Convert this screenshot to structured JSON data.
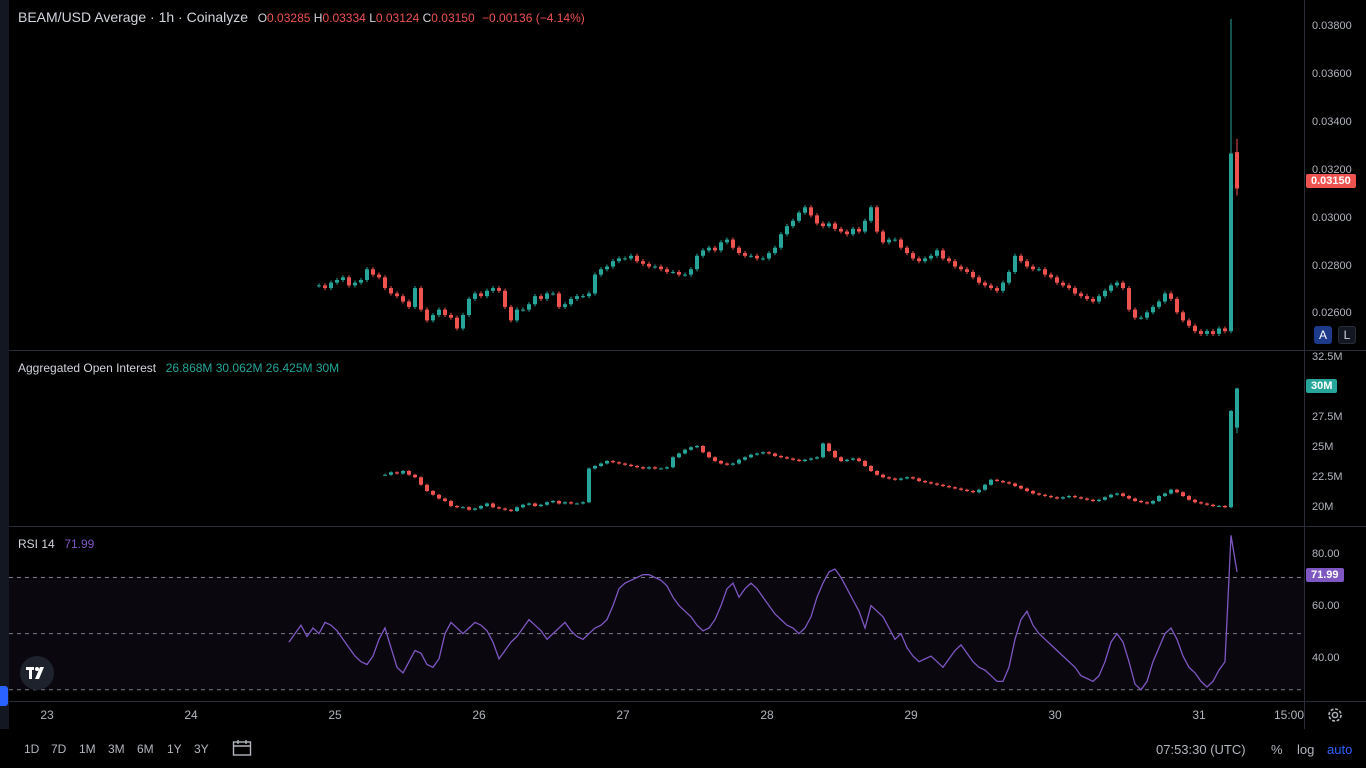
{
  "price_legend": {
    "title": "BEAM/USD Average · 1h · Coinalyze",
    "o_label": "O",
    "o": "0.03285",
    "h_label": "H",
    "h": "0.03334",
    "l_label": "L",
    "l": "0.03124",
    "c_label": "C",
    "c": "0.03150",
    "change": "−0.00136 (−4.14%)"
  },
  "oi_legend": {
    "title": "Aggregated Open Interest",
    "values": "26.868M 30.062M 26.425M 30M"
  },
  "rsi_legend": {
    "title": "RSI 14",
    "value": "71.99"
  },
  "price_axis": {
    "ticks": [
      "0.03800",
      "0.03600",
      "0.03400",
      "0.03200",
      "0.03000",
      "0.02800",
      "0.02600"
    ],
    "last_price": "0.03150"
  },
  "oi_axis": {
    "ticks": [
      "32.5M",
      "27.5M",
      "25M",
      "22.5M",
      "20M"
    ],
    "last": "30M"
  },
  "rsi_axis": {
    "ticks": [
      "80.00",
      "60.00",
      "40.00"
    ],
    "last": "71.99"
  },
  "scale_buttons": {
    "auto_label": "A",
    "log_label": "L"
  },
  "time_axis": {
    "ticks": [
      "23",
      "24",
      "25",
      "26",
      "27",
      "28",
      "29",
      "30",
      "31",
      "15:00"
    ]
  },
  "toolbar": {
    "ranges": [
      "1D",
      "7D",
      "1M",
      "3M",
      "6M",
      "1Y",
      "3Y"
    ],
    "clock": "07:53:30 (UTC)",
    "percent": "%",
    "log": "log",
    "auto": "auto"
  },
  "colors": {
    "up": "#26a69a",
    "down": "#ef5350",
    "rsi": "#7e57c2",
    "accent": "#2962ff"
  },
  "chart_data": [
    {
      "type": "candlestick",
      "name": "BEAM/USD price, 1h",
      "x_range": [
        "22 (partial)",
        "31 15:00"
      ],
      "ylim": [
        0.0255,
        0.0385
      ],
      "closes": [
        0.0279,
        0.0278,
        0.028,
        0.0281,
        0.0282,
        0.0279,
        0.028,
        0.0281,
        0.0285,
        0.0283,
        0.0282,
        0.0278,
        0.0276,
        0.0275,
        0.0273,
        0.0271,
        0.0278,
        0.027,
        0.0266,
        0.0268,
        0.027,
        0.0268,
        0.0267,
        0.0263,
        0.0268,
        0.0274,
        0.0276,
        0.0275,
        0.0277,
        0.0278,
        0.0277,
        0.0271,
        0.0266,
        0.027,
        0.027,
        0.0272,
        0.0275,
        0.0274,
        0.0276,
        0.0276,
        0.0271,
        0.0272,
        0.0274,
        0.0275,
        0.0275,
        0.0276,
        0.0283,
        0.0285,
        0.0286,
        0.0288,
        0.0289,
        0.0289,
        0.029,
        0.0288,
        0.0287,
        0.0286,
        0.0286,
        0.0285,
        0.0284,
        0.0284,
        0.0283,
        0.0283,
        0.0285,
        0.029,
        0.0292,
        0.0293,
        0.0292,
        0.0295,
        0.0296,
        0.0293,
        0.0291,
        0.029,
        0.029,
        0.0289,
        0.0289,
        0.0291,
        0.0293,
        0.0298,
        0.0301,
        0.0303,
        0.0306,
        0.0308,
        0.0305,
        0.0302,
        0.0301,
        0.0302,
        0.03,
        0.0299,
        0.0298,
        0.03,
        0.0299,
        0.0303,
        0.0308,
        0.0299,
        0.0295,
        0.0296,
        0.0296,
        0.0293,
        0.0291,
        0.0289,
        0.0288,
        0.0289,
        0.029,
        0.0292,
        0.0289,
        0.0288,
        0.0286,
        0.0285,
        0.0284,
        0.0282,
        0.028,
        0.0279,
        0.0278,
        0.0277,
        0.028,
        0.0284,
        0.029,
        0.0288,
        0.0286,
        0.0285,
        0.0285,
        0.0283,
        0.0282,
        0.028,
        0.0279,
        0.0278,
        0.0276,
        0.0275,
        0.0274,
        0.0273,
        0.0275,
        0.0277,
        0.0279,
        0.028,
        0.0278,
        0.027,
        0.0267,
        0.0267,
        0.0269,
        0.0271,
        0.0273,
        0.0276,
        0.0274,
        0.0269,
        0.0266,
        0.0264,
        0.0262,
        0.0261,
        0.0262,
        0.0261,
        0.0263,
        0.0262,
        0.0328,
        0.0315
      ],
      "last": {
        "open": 0.03285,
        "high": 0.03334,
        "low": 0.03124,
        "close": 0.0315
      },
      "spike_high": 0.0378
    },
    {
      "type": "candlestick",
      "name": "Aggregated Open Interest",
      "ylim_millions": [
        19.0,
        33.0
      ],
      "closes_millions": [
        23.1,
        23.3,
        23.2,
        23.4,
        23.1,
        22.9,
        22.3,
        21.8,
        21.5,
        21.2,
        21.0,
        20.6,
        20.5,
        20.5,
        20.3,
        20.4,
        20.6,
        20.8,
        20.5,
        20.4,
        20.3,
        20.2,
        20.5,
        20.7,
        20.8,
        20.6,
        20.7,
        20.9,
        21.0,
        20.8,
        20.9,
        20.8,
        20.8,
        20.9,
        23.6,
        23.8,
        24.0,
        24.2,
        24.1,
        24.0,
        23.9,
        23.8,
        23.7,
        23.6,
        23.7,
        23.6,
        23.6,
        23.7,
        24.5,
        24.8,
        25.1,
        25.3,
        25.4,
        24.9,
        24.5,
        24.2,
        24.0,
        23.9,
        24.0,
        24.3,
        24.5,
        24.7,
        24.8,
        24.9,
        24.8,
        24.6,
        24.5,
        24.4,
        24.3,
        24.2,
        24.3,
        24.4,
        24.5,
        25.6,
        25.0,
        24.5,
        24.2,
        24.3,
        24.4,
        24.2,
        23.8,
        23.4,
        23.1,
        22.9,
        22.8,
        22.7,
        22.8,
        22.9,
        22.8,
        22.6,
        22.5,
        22.4,
        22.3,
        22.2,
        22.1,
        22.0,
        21.9,
        21.8,
        21.7,
        21.9,
        22.3,
        22.7,
        22.6,
        22.5,
        22.4,
        22.2,
        22.0,
        21.8,
        21.6,
        21.5,
        21.4,
        21.3,
        21.2,
        21.3,
        21.4,
        21.3,
        21.2,
        21.1,
        21.0,
        21.1,
        21.3,
        21.5,
        21.6,
        21.4,
        21.2,
        21.0,
        20.9,
        20.8,
        21.0,
        21.4,
        21.6,
        21.9,
        21.7,
        21.4,
        21.1,
        20.9,
        20.8,
        20.7,
        20.6,
        20.6,
        20.5,
        28.2,
        30.0
      ],
      "last": {
        "open": 26.868,
        "high": 30.062,
        "low": 26.425,
        "close": 30.0
      }
    },
    {
      "type": "line",
      "name": "RSI 14",
      "ylim": [
        26,
        88
      ],
      "bands": {
        "upper": 70,
        "middle": 50,
        "lower": 30
      },
      "values": [
        47,
        50,
        53,
        49,
        52,
        50,
        54,
        53,
        51,
        48,
        45,
        42,
        40,
        39,
        42,
        48,
        52,
        45,
        38,
        36,
        40,
        44,
        43,
        39,
        38,
        41,
        50,
        54,
        52,
        50,
        52,
        54,
        53,
        51,
        47,
        41,
        44,
        47,
        49,
        52,
        55,
        53,
        51,
        48,
        50,
        52,
        54,
        51,
        49,
        48,
        50,
        52,
        53,
        55,
        60,
        66,
        68,
        69,
        70,
        71,
        71,
        70,
        69,
        67,
        63,
        60,
        58,
        56,
        53,
        51,
        52,
        55,
        60,
        66,
        68,
        63,
        66,
        68,
        66,
        63,
        60,
        57,
        55,
        53,
        52,
        50,
        52,
        56,
        63,
        68,
        72,
        73,
        70,
        66,
        62,
        58,
        52,
        60,
        58,
        56,
        52,
        48,
        50,
        45,
        42,
        40,
        41,
        42,
        40,
        38,
        41,
        44,
        46,
        43,
        40,
        38,
        37,
        35,
        33,
        33,
        38,
        48,
        55,
        58,
        53,
        50,
        48,
        46,
        44,
        42,
        40,
        38,
        35,
        34,
        33,
        35,
        40,
        47,
        50,
        47,
        40,
        32,
        30,
        33,
        40,
        45,
        50,
        52,
        48,
        42,
        38,
        36,
        33,
        31,
        33,
        37,
        40,
        85,
        71.99
      ]
    }
  ]
}
